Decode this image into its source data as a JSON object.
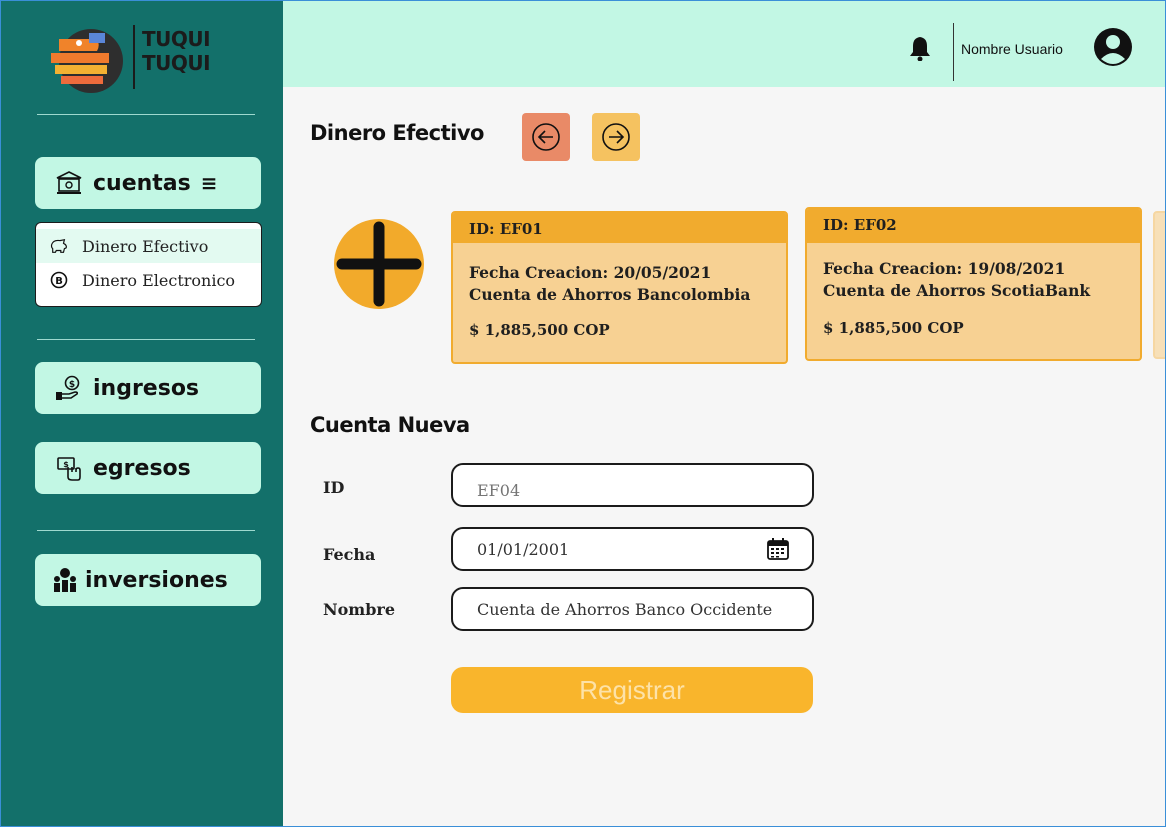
{
  "app": {
    "logo_line1": "TUQUI",
    "logo_line2": "TUQUI",
    "accent": "#13706a",
    "topbar_color": "#c2f7e4"
  },
  "sidebar": {
    "items": [
      {
        "label": "cuentas",
        "icon": "bank-icon",
        "has_menu": true
      },
      {
        "label": "ingresos",
        "icon": "hand-coin-icon"
      },
      {
        "label": "egresos",
        "icon": "bill-hand-icon"
      },
      {
        "label": "inversiones",
        "icon": "investors-icon"
      }
    ],
    "submenu": [
      {
        "label": "Dinero Efectivo",
        "icon": "piggy-bank-icon",
        "active": true
      },
      {
        "label": "Dinero Electronico",
        "icon": "bitcoin-icon"
      }
    ]
  },
  "header": {
    "username": "Nombre Usuario",
    "bell_icon": "bell-icon",
    "avatar_icon": "user-avatar-icon"
  },
  "main": {
    "title": "Dinero Efectivo",
    "cards": [
      {
        "id": "ID: EF01",
        "fecha_label": "Fecha Creacion:",
        "fecha": "20/05/2021",
        "nombre": "Cuenta de Ahorros Bancolombia",
        "monto": "$ 1,885,500 COP"
      },
      {
        "id": "ID: EF02",
        "fecha_label": "Fecha Creacion:",
        "fecha": "19/08/2021",
        "nombre": "Cuenta de Ahorros ScotiaBank",
        "monto": "$ 1,885,500 COP"
      }
    ],
    "form": {
      "title": "Cuenta Nueva",
      "id_label": "ID",
      "id_placeholder": "EF04",
      "fecha_label": "Fecha",
      "fecha_value": "01/01/2001",
      "nombre_label": "Nombre",
      "nombre_value": "Cuenta de Ahorros Banco Occidente",
      "submit_label": "Registrar"
    }
  }
}
